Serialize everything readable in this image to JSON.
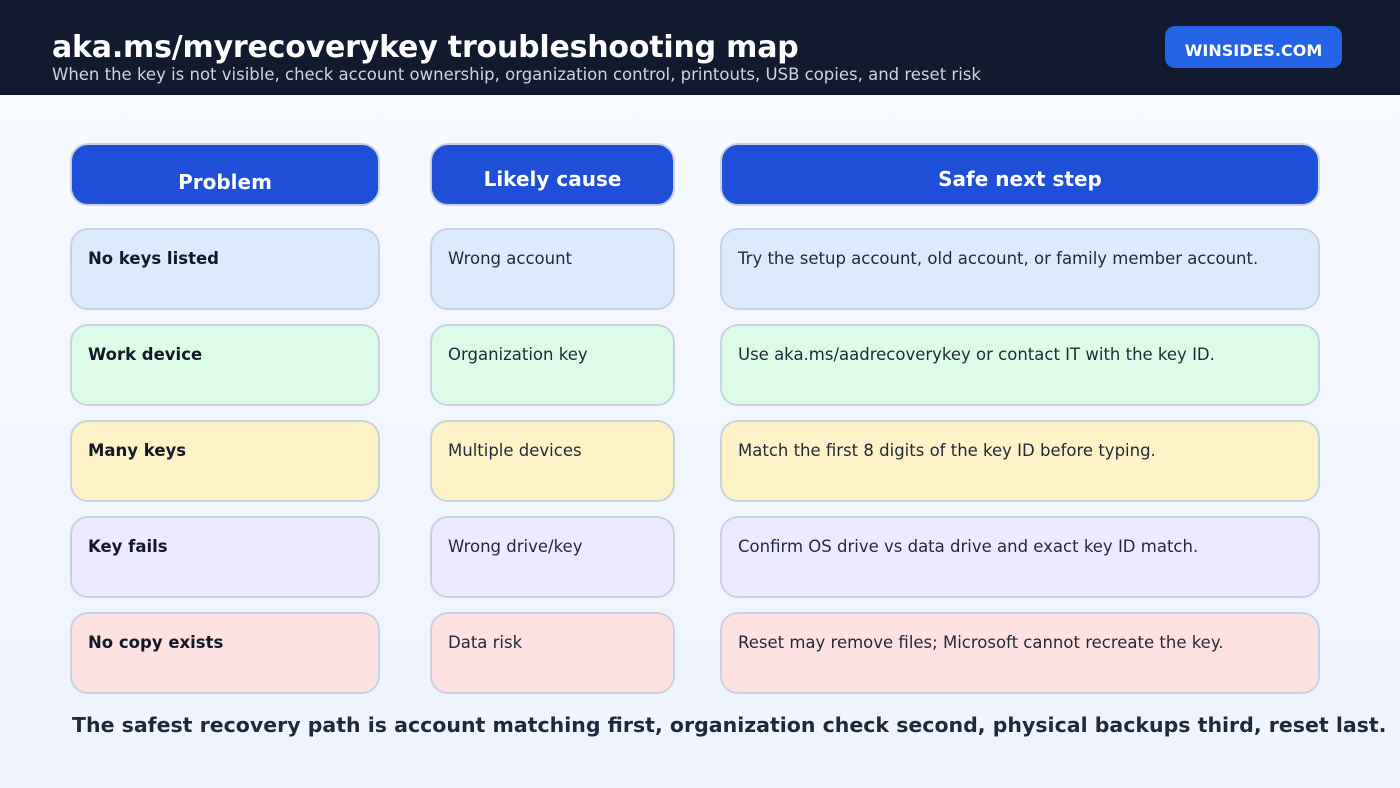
{
  "header": {
    "title": "aka.ms/myrecoverykey troubleshooting map",
    "subtitle": "When the key is not visible, check account ownership, organization control, printouts, USB copies, and reset risk",
    "brand": "WINSIDES.COM"
  },
  "columns": {
    "problem": "Problem",
    "cause": "Likely cause",
    "step": "Safe next step"
  },
  "rows": [
    {
      "problem": "No keys listed",
      "cause": "Wrong account",
      "step": "Try the setup account, old account, or family member account.",
      "color": "#dceafe"
    },
    {
      "problem": "Work device",
      "cause": "Organization key",
      "step": "Use aka.ms/aadrecoverykey or contact IT with the key ID.",
      "color": "#dcfce7"
    },
    {
      "problem": "Many keys",
      "cause": "Multiple devices",
      "step": "Match the first 8 digits of the key ID before typing.",
      "color": "#fef3c7"
    },
    {
      "problem": "Key fails",
      "cause": "Wrong drive/key",
      "step": "Confirm OS drive vs data drive and exact key ID match.",
      "color": "#ede9fe"
    },
    {
      "problem": "No copy exists",
      "cause": "Data risk",
      "step": "Reset may remove files; Microsoft cannot recreate the key.",
      "color": "#fee2e2"
    }
  ],
  "footer": "The safest recovery path is account matching first, organization check second, physical backups third, reset last.",
  "colors": {
    "header_bg": "#111a2e",
    "accent": "#1f4fd8",
    "brand_button": "#2463e6"
  }
}
